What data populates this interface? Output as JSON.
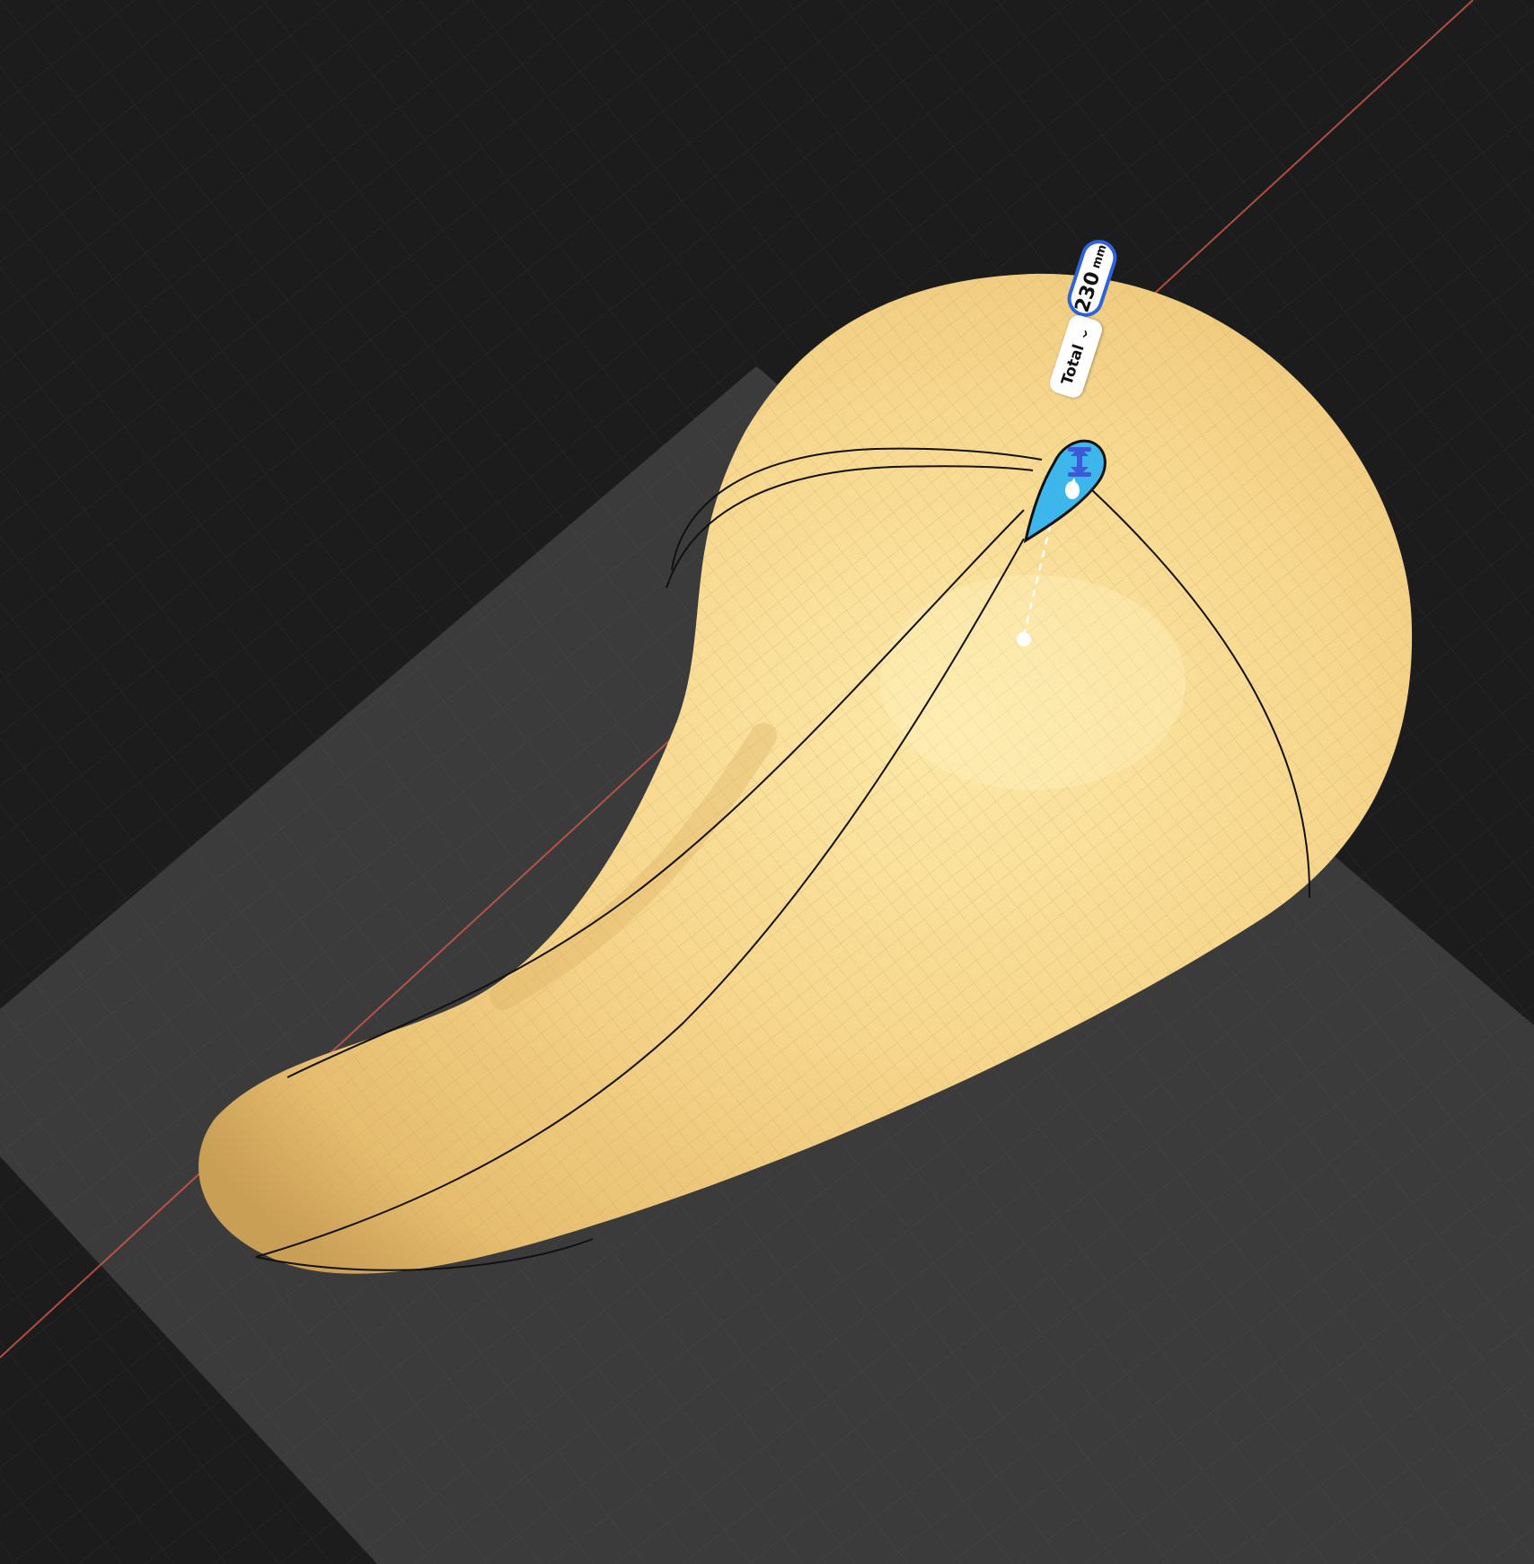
{
  "dimension": {
    "value": "230",
    "unit": "mm"
  },
  "measure_mode": {
    "label": "Total",
    "chevron": "chevron-down-icon"
  },
  "handle": {
    "icon": "resize-arrows-icon",
    "color": "#3db6ec",
    "arrow_color": "#3b5bd6"
  },
  "scene": {
    "background": "#1c1c1c",
    "ground_plane": "#3b3b3b",
    "model_color": "#f2cf85",
    "axis_color": "#d8584a"
  }
}
